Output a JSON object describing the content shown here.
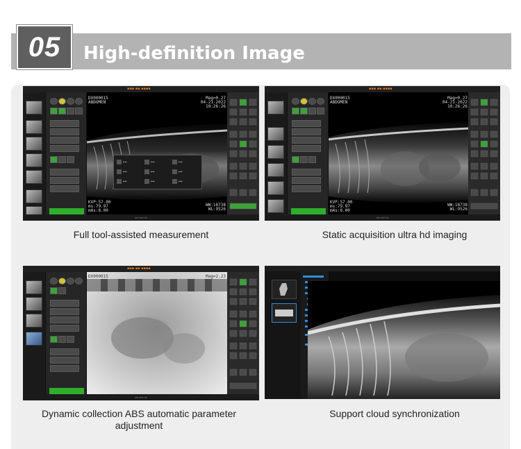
{
  "header": {
    "number": "05",
    "title": "High-definition Image"
  },
  "colors": {
    "header_bar": "#b3b3b3",
    "badge": "#5f5f5f",
    "panel": "#eeeeee",
    "accent_green": "#2fae2b",
    "title_orange": "#d07a2a"
  },
  "cards": [
    {
      "caption": "Full tool-assisted measurement",
      "overlay": {
        "top_left": [
          "DX000015",
          "ABDOMEN"
        ],
        "top_right": [
          "Mag=0.27",
          "04-21-2022",
          "10:26:26"
        ],
        "bottom_left": [
          "KVP:57.00",
          "ms:79.97",
          "mAs:8.00"
        ],
        "bottom_right": [
          "WW:18738",
          "WL:9526"
        ]
      }
    },
    {
      "caption": "Static acquisition ultra hd imaging",
      "overlay": {
        "top_left": [
          "DX000015",
          "ABDOMEN"
        ],
        "top_right": [
          "Mag=0.27",
          "04-21-2022",
          "10:26:26"
        ],
        "bottom_left": [
          "KVP:57.00",
          "ms:79.97",
          "mAs:8.00"
        ],
        "bottom_right": [
          "WW:18738",
          "WL:9526"
        ]
      }
    },
    {
      "caption": "Dynamic collection ABS automatic parameter adjustment",
      "overlay": {
        "top_left": [
          "DX000015"
        ],
        "top_right": [
          "Mag=2.23"
        ],
        "bottom_left": [],
        "bottom_right": []
      }
    },
    {
      "caption": "Support cloud synchronization",
      "overlay": {
        "top_left": [],
        "top_right": [],
        "bottom_left": [],
        "bottom_right": []
      }
    }
  ]
}
